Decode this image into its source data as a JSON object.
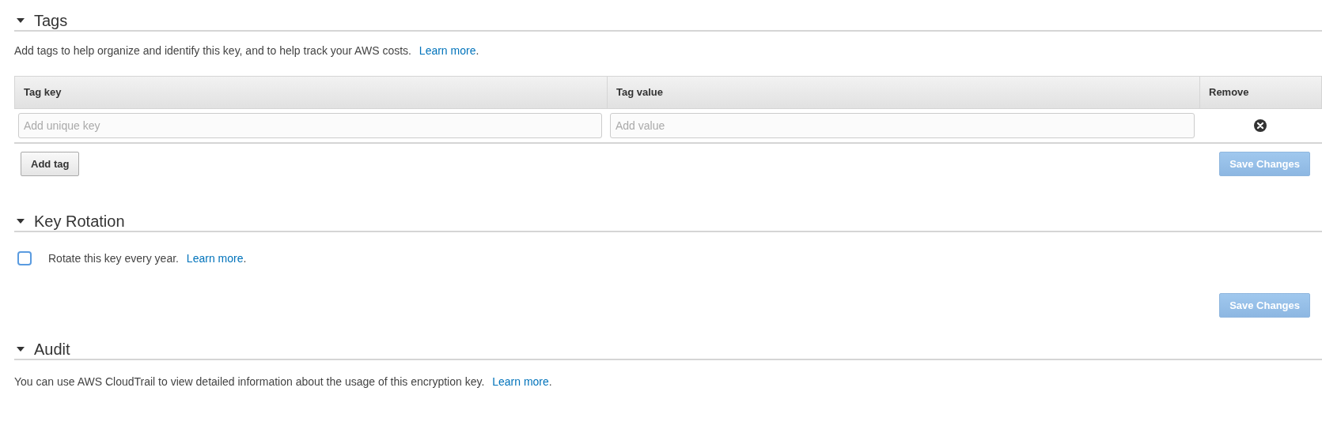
{
  "sections": [
    {
      "kind": "tags",
      "title": "Tags",
      "expanded": true,
      "description": {
        "text": "Add tags to help organize and identify this key, and to help track your AWS costs.",
        "link": "Learn more",
        "after": "."
      },
      "table": {
        "columns": [
          "Tag key",
          "Tag value",
          "Remove"
        ],
        "rows": [
          {
            "key_placeholder": "Add unique key",
            "value_placeholder": "Add value"
          }
        ]
      },
      "add_button": "Add tag",
      "save_button": {
        "label": "Save Changes",
        "disabled": true
      }
    },
    {
      "kind": "rotation",
      "title": "Key Rotation",
      "expanded": true,
      "checkbox": {
        "checked": false,
        "text": "Rotate this key every year.",
        "link": "Learn more",
        "after": "."
      },
      "save_button": {
        "label": "Save Changes",
        "disabled": true
      }
    },
    {
      "kind": "audit",
      "title": "Audit",
      "expanded": true,
      "description": {
        "text": "You can use AWS CloudTrail to view detailed information about the usage of this encryption key.",
        "link": "Learn more",
        "after": "."
      }
    }
  ]
}
